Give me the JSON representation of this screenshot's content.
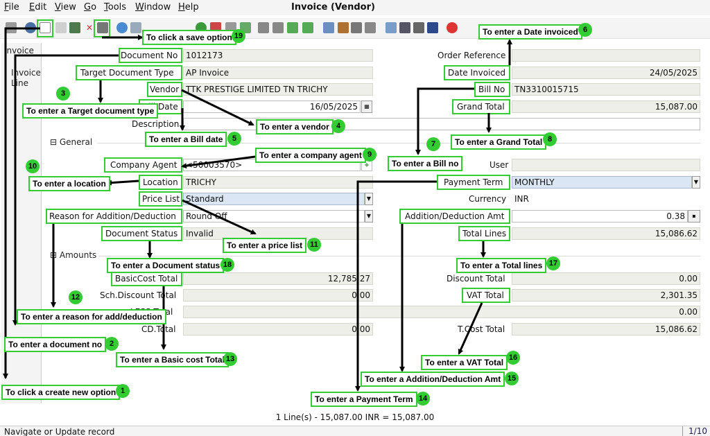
{
  "menu": [
    "File",
    "Edit",
    "View",
    "Go",
    "Tools",
    "Window",
    "Help"
  ],
  "window_title": "Invoice (Vendor)",
  "tabs": [
    "Invoice",
    "Invoice Line"
  ],
  "sections": {
    "general": "General",
    "amounts": "Amounts"
  },
  "fields": {
    "document_no": {
      "label": "Document No",
      "value": "1012173"
    },
    "target_document_type": {
      "label": "Target Document Type",
      "value": "AP Invoice"
    },
    "vendor": {
      "label": "Vendor",
      "value": "TTK PRESTIGE LIMITED TN TRICHY"
    },
    "bill_date": {
      "label": "Bill Date",
      "value": "16/05/2025"
    },
    "description": {
      "label": "Description",
      "value": ""
    },
    "order_reference": {
      "label": "Order Reference",
      "value": ""
    },
    "date_invoiced": {
      "label": "Date Invoiced",
      "value": "24/05/2025"
    },
    "bill_no": {
      "label": "Bill No",
      "value": "TN3310015715"
    },
    "grand_total": {
      "label": "Grand Total",
      "value": "15,087.00"
    },
    "company_agent": {
      "label": "Company Agent",
      "value": "<50003570>"
    },
    "location": {
      "label": "Location",
      "value": "TRICHY"
    },
    "price_list": {
      "label": "Price List",
      "value": "Standard"
    },
    "reason_add_deduct": {
      "label": "Reason for Addition/Deduction",
      "value": "Round Off"
    },
    "document_status": {
      "label": "Document Status",
      "value": "Invalid"
    },
    "user": {
      "label": "User",
      "value": ""
    },
    "payment_term": {
      "label": "Payment Term",
      "value": "MONTHLY"
    },
    "currency": {
      "label": "Currency",
      "value": "INR"
    },
    "add_deduct_amt": {
      "label": "Addition/Deduction Amt",
      "value": "0.38"
    },
    "total_lines": {
      "label": "Total Lines",
      "value": "15,086.62"
    },
    "basic_cost_total": {
      "label": "BasicCost Total",
      "value": "12,785.27"
    },
    "sch_discount_total": {
      "label": "Sch.Discount Total",
      "value": "0.00"
    },
    "less_total": {
      "label": "LESS Total",
      "value": ""
    },
    "cd_total": {
      "label": "CD.Total",
      "value": "0.00"
    },
    "discount_total": {
      "label": "Discount Total",
      "value": "0.00"
    },
    "vat_total": {
      "label": "VAT Total",
      "value": "2,301.35"
    },
    "extra_total": {
      "label": "",
      "value": "0.00"
    },
    "t_cost_total": {
      "label": "T.Cost Total",
      "value": "15,086.62"
    }
  },
  "annotations": {
    "a1": {
      "text": "To click a create new option",
      "n": "1"
    },
    "a2": {
      "text": "To enter a document no",
      "n": "2"
    },
    "a3": {
      "text": "To enter a Target document type",
      "n": "3"
    },
    "a4": {
      "text": "To enter a vendor",
      "n": "4"
    },
    "a5": {
      "text": "To enter a Bill date",
      "n": "5"
    },
    "a6": {
      "text": "To enter a Date invoiced",
      "n": "6"
    },
    "a7": {
      "text": "To enter a Bill no",
      "n": "7"
    },
    "a8": {
      "text": "To enter a Grand Total",
      "n": "8"
    },
    "a9": {
      "text": "To enter a company agent",
      "n": "9"
    },
    "a10": {
      "text": "To enter a location",
      "n": "10"
    },
    "a11": {
      "text": "To enter a price list",
      "n": "11"
    },
    "a12": {
      "text": "To enter a reason for add/deduction",
      "n": "12"
    },
    "a13": {
      "text": "To enter a Basic cost Total",
      "n": "13"
    },
    "a14": {
      "text": "To enter a Payment Term",
      "n": "14"
    },
    "a15": {
      "text": "To enter a Addition/Deduction Amt",
      "n": "15"
    },
    "a16": {
      "text": "To enter a VAT Total",
      "n": "16"
    },
    "a17": {
      "text": "To enter a Total lines",
      "n": "17"
    },
    "a18": {
      "text": "To enter a Document status",
      "n": "18"
    },
    "a19": {
      "text": "To click a save option",
      "n": "19"
    }
  },
  "status_line": "1 Line(s) - 15,087.00 INR = 15,087.00",
  "status_bar": "Navigate or Update record",
  "pager": "1/10",
  "colors": {
    "annotation": "#33cc33",
    "readonly_field": "#efefe9",
    "selected_field": "#dbe6f4"
  }
}
